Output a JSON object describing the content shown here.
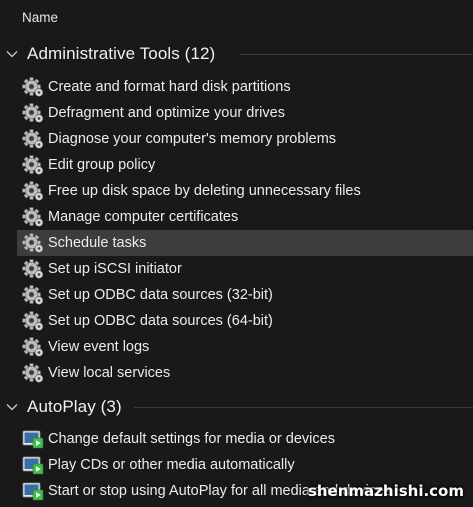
{
  "column_header": "Name",
  "groups": [
    {
      "title": "Administrative Tools (12)",
      "items": [
        {
          "label": "Create and format hard disk partitions",
          "icon": "admin-tools-gear-icon"
        },
        {
          "label": "Defragment and optimize your drives",
          "icon": "admin-tools-gear-icon"
        },
        {
          "label": "Diagnose your computer's memory problems",
          "icon": "admin-tools-gear-icon"
        },
        {
          "label": "Edit group policy",
          "icon": "admin-tools-gear-icon"
        },
        {
          "label": "Free up disk space by deleting unnecessary files",
          "icon": "admin-tools-gear-icon"
        },
        {
          "label": "Manage computer certificates",
          "icon": "admin-tools-gear-icon"
        },
        {
          "label": "Schedule tasks",
          "icon": "admin-tools-gear-icon",
          "selected": true
        },
        {
          "label": "Set up iSCSI initiator",
          "icon": "admin-tools-gear-icon"
        },
        {
          "label": "Set up ODBC data sources (32-bit)",
          "icon": "admin-tools-gear-icon"
        },
        {
          "label": "Set up ODBC data sources (64-bit)",
          "icon": "admin-tools-gear-icon"
        },
        {
          "label": "View event logs",
          "icon": "admin-tools-gear-icon"
        },
        {
          "label": "View local services",
          "icon": "admin-tools-gear-icon"
        }
      ]
    },
    {
      "title": "AutoPlay (3)",
      "items": [
        {
          "label": "Change default settings for media or devices",
          "icon": "autoplay-icon"
        },
        {
          "label": "Play CDs or other media automatically",
          "icon": "autoplay-icon"
        },
        {
          "label": "Start or stop using AutoPlay for all media and devices",
          "icon": "autoplay-icon"
        }
      ]
    }
  ],
  "watermark": "shenmazhishi.com",
  "colors": {
    "background": "#191919",
    "selected_row": "#3d3d3d",
    "text": "#ececec",
    "autoplay_green": "#3fbf4a"
  }
}
